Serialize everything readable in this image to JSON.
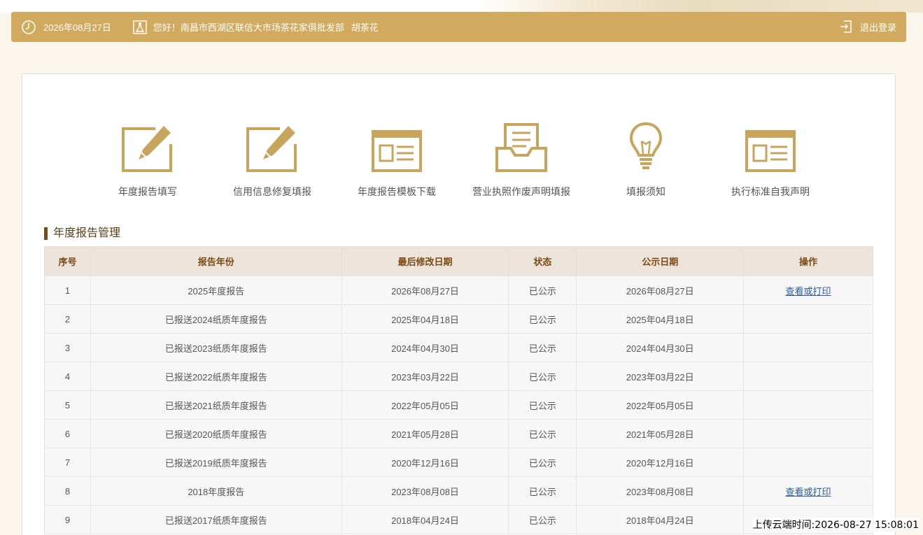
{
  "header": {
    "date": "2026年08月27日",
    "greeting": "您好！南昌市西湖区联信大市场茶花家俱批发部",
    "user_name": "胡茶花",
    "logout_label": "退出登录"
  },
  "menu": [
    {
      "label": "年度报告填写",
      "icon": "edit-icon"
    },
    {
      "label": "信用信息修复填报",
      "icon": "edit-icon"
    },
    {
      "label": "年度报告模板下载",
      "icon": "template-icon"
    },
    {
      "label": "营业执照作废声明填报",
      "icon": "inbox-document-icon"
    },
    {
      "label": "填报须知",
      "icon": "lightbulb-icon"
    },
    {
      "label": "执行标准自我声明",
      "icon": "template-icon"
    }
  ],
  "section_title": "年度报告管理",
  "table": {
    "headers": [
      "序号",
      "报告年份",
      "最后修改日期",
      "状态",
      "公示日期",
      "操作"
    ],
    "rows": [
      {
        "no": "1",
        "year": "2025年度报告",
        "modified": "2026年08月27日",
        "status": "已公示",
        "publish": "2026年08月27日",
        "action": "查看或打印"
      },
      {
        "no": "2",
        "year": "已报送2024纸质年度报告",
        "modified": "2025年04月18日",
        "status": "已公示",
        "publish": "2025年04月18日",
        "action": ""
      },
      {
        "no": "3",
        "year": "已报送2023纸质年度报告",
        "modified": "2024年04月30日",
        "status": "已公示",
        "publish": "2024年04月30日",
        "action": ""
      },
      {
        "no": "4",
        "year": "已报送2022纸质年度报告",
        "modified": "2023年03月22日",
        "status": "已公示",
        "publish": "2023年03月22日",
        "action": ""
      },
      {
        "no": "5",
        "year": "已报送2021纸质年度报告",
        "modified": "2022年05月05日",
        "status": "已公示",
        "publish": "2022年05月05日",
        "action": ""
      },
      {
        "no": "6",
        "year": "已报送2020纸质年度报告",
        "modified": "2021年05月28日",
        "status": "已公示",
        "publish": "2021年05月28日",
        "action": ""
      },
      {
        "no": "7",
        "year": "已报送2019纸质年度报告",
        "modified": "2020年12月16日",
        "status": "已公示",
        "publish": "2020年12月16日",
        "action": ""
      },
      {
        "no": "8",
        "year": "2018年度报告",
        "modified": "2023年08月08日",
        "status": "已公示",
        "publish": "2023年08月08日",
        "action": "查看或打印"
      },
      {
        "no": "9",
        "year": "已报送2017纸质年度报告",
        "modified": "2018年04月24日",
        "status": "已公示",
        "publish": "2018年04月24日",
        "action": ""
      }
    ]
  },
  "upload_time": "上传云端时间:2026-08-27 15:08:01",
  "colors": {
    "accent": "#d1aa5f",
    "icon": "#c9a45c",
    "section_bar": "#7a4a12",
    "link": "#2a5aa0"
  }
}
